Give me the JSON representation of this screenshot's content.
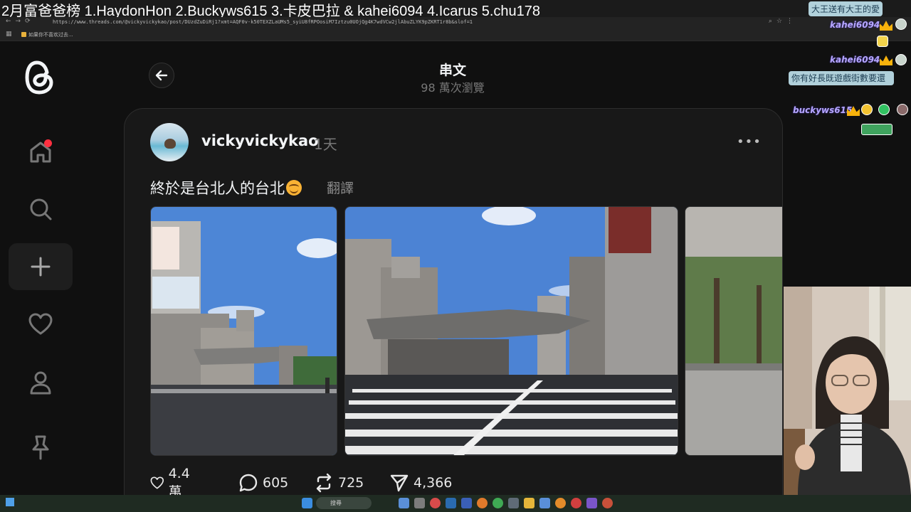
{
  "ticker": {
    "text": "2月富爸爸榜   1.HaydonHon   2.Buckyws615  3.卡皮巴拉 & kahei6094   4.Icarus    5.chu178"
  },
  "browser": {
    "url": "https://www.threads.com/@vickyvickykao/post/DUzdZuDiRj1?xmt=AQF0v-k50TEXZLaUMs5_syiU8fRPOosiM7Iztzu0UOjQg4K7wdVCw2jlAbuZLYK9pZKRT1r8b&slof=1",
    "bookmark": "如果你不喜欢过去..."
  },
  "sidebar": {
    "items": [
      {
        "name": "home",
        "icon": "home-icon"
      },
      {
        "name": "search",
        "icon": "search-icon"
      },
      {
        "name": "create",
        "icon": "plus-icon"
      },
      {
        "name": "activity",
        "icon": "heart-icon"
      },
      {
        "name": "profile",
        "icon": "person-icon"
      },
      {
        "name": "pinned",
        "icon": "pin-icon"
      }
    ]
  },
  "header": {
    "title": "串文",
    "views": "98 萬次瀏覽"
  },
  "post": {
    "username": "vickyvickykao",
    "time": "1天",
    "text": "終於是台北人的台北",
    "translate_label": "翻譯",
    "stats": {
      "likes": "4.4 萬",
      "comments": "605",
      "reposts": "725",
      "shares": "4,366"
    }
  },
  "chat": {
    "messages": [
      {
        "name": "",
        "text": "大王送有大王的愛"
      },
      {
        "name": "kahei6094",
        "text": ""
      },
      {
        "name": "kahei6094",
        "text": ""
      },
      {
        "name": "",
        "text": "你有好長既遊戲街數要還"
      },
      {
        "name": "buckyws615",
        "text": ""
      }
    ]
  },
  "taskbar": {
    "search_label": "搜尋"
  },
  "colors": {
    "background": "#101010",
    "card": "#181818",
    "accent_red": "#ff3040",
    "text": "#f3f5f7",
    "muted": "#777777"
  }
}
